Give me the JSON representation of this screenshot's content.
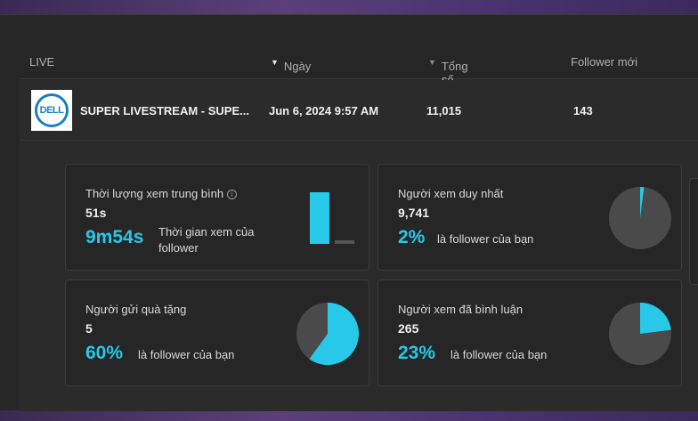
{
  "table": {
    "headers": {
      "live": "LIVE",
      "date": "Ngày",
      "views": "Tổng số lượt xem",
      "new_followers": "Follower mới"
    },
    "row": {
      "title": "SUPER LIVESTREAM - SUPE...",
      "date": "Jun 6, 2024 9:57 AM",
      "views": "11,015",
      "new_followers": "143",
      "logo_text": "DELL"
    }
  },
  "cards": {
    "avg_watch": {
      "label": "Thời lượng xem trung bình",
      "value": "51s",
      "follower_value": "9m54s",
      "follower_text_line1": "Thời gian xem của",
      "follower_text_line2": "follower"
    },
    "unique_viewers": {
      "label": "Người xem duy nhất",
      "value": "9,741",
      "percent": "2%",
      "percent_text": "là follower của bạn",
      "fraction": 0.02
    },
    "gifters": {
      "label": "Người gửi quà tặng",
      "value": "5",
      "percent": "60%",
      "percent_text": "là follower của bạn",
      "fraction": 0.6
    },
    "commenters": {
      "label": "Người xem đã bình luận",
      "value": "265",
      "percent": "23%",
      "percent_text": "là follower của bạn",
      "fraction": 0.23
    }
  },
  "colors": {
    "accent": "#28c8e8",
    "pie_bg": "#4a4a4a"
  }
}
